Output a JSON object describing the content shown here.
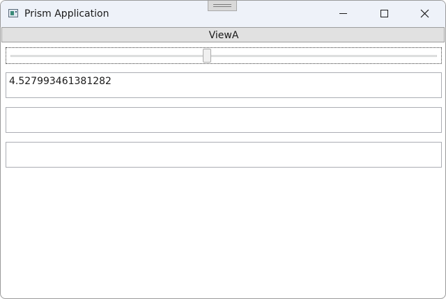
{
  "window": {
    "title": "Prism Application"
  },
  "tab": {
    "label": "ViewA"
  },
  "slider": {
    "value_fraction": 0.46
  },
  "textboxes": [
    {
      "value": "4.527993461381282"
    },
    {
      "value": ""
    },
    {
      "value": ""
    }
  ],
  "icons": {
    "app": "app-window-icon",
    "minimize": "minimize-icon",
    "maximize": "maximize-icon",
    "close": "close-icon",
    "grip": "drag-grip-icon"
  }
}
